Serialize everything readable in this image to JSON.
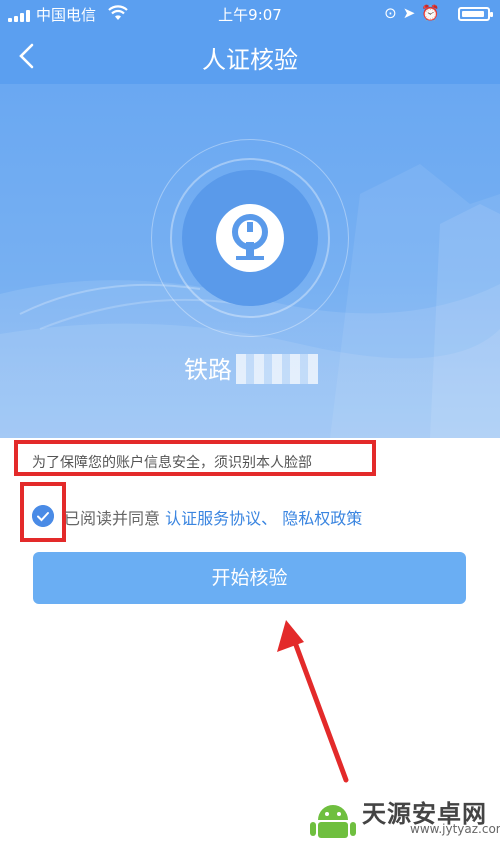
{
  "status_bar": {
    "carrier": "中国电信",
    "time": "上午9:07"
  },
  "nav": {
    "title": "人证核验",
    "back_icon": "chevron-left-icon"
  },
  "hero": {
    "name": "铁路"
  },
  "notice": {
    "text": "为了保障您的账户信息安全，须识别本人脸部"
  },
  "agreement": {
    "prefix": "已阅读并同意 ",
    "link_service": "认证服务协议",
    "separator": "、 ",
    "link_privacy": "隐私权政策",
    "checked": true
  },
  "start_button": {
    "label": "开始核验"
  },
  "watermark": {
    "brand": "天源安卓网",
    "url": "www.jytyaz.com"
  },
  "colors": {
    "primary": "#5b9ff0",
    "button": "#6aaef3",
    "link": "#3a85e0",
    "highlight": "#e32a2a"
  }
}
